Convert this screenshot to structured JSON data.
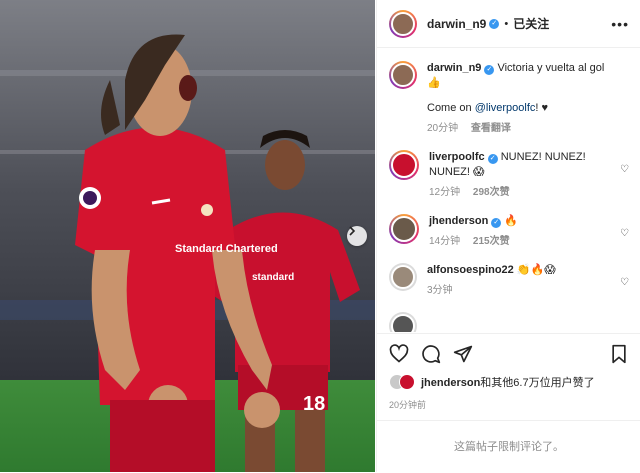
{
  "photo": {
    "shirt_sponsor": "Standard Chartered",
    "shirt_number": "18"
  },
  "header": {
    "username": "darwin_n9",
    "follow_status": "已关注",
    "more_icon": "more-horizontal-icon"
  },
  "caption": {
    "username": "darwin_n9",
    "text": "Victoria y vuelta al gol",
    "emoji": "👍",
    "line2_prefix": "Come on ",
    "mention": "@liverpoolfc",
    "line2_suffix": "! ♥",
    "time": "20分钟",
    "translate": "查看翻译"
  },
  "comments": [
    {
      "username": "liverpoolfc",
      "text": "NUNEZ! NUNEZ! NUNEZ! 😱",
      "time": "12分钟",
      "likes": "298次赞"
    },
    {
      "username": "jhenderson",
      "text": "🔥",
      "time": "14分钟",
      "likes": "215次赞"
    },
    {
      "username": "alfonsoespino22",
      "text": "👏🔥😱",
      "time": "3分钟",
      "likes": ""
    }
  ],
  "actions": {
    "like_icon": "heart-icon",
    "comment_icon": "comment-icon",
    "share_icon": "send-icon",
    "save_icon": "bookmark-icon"
  },
  "likes": {
    "user": "jhenderson",
    "text": "和其他6.7万位用户赞了"
  },
  "post_time": "20分钟前",
  "comments_limited": "这篇帖子限制评论了。",
  "colors": {
    "liverpool_red": "#c8102e",
    "verified_blue": "#3897f0",
    "mention_blue": "#00376b"
  }
}
